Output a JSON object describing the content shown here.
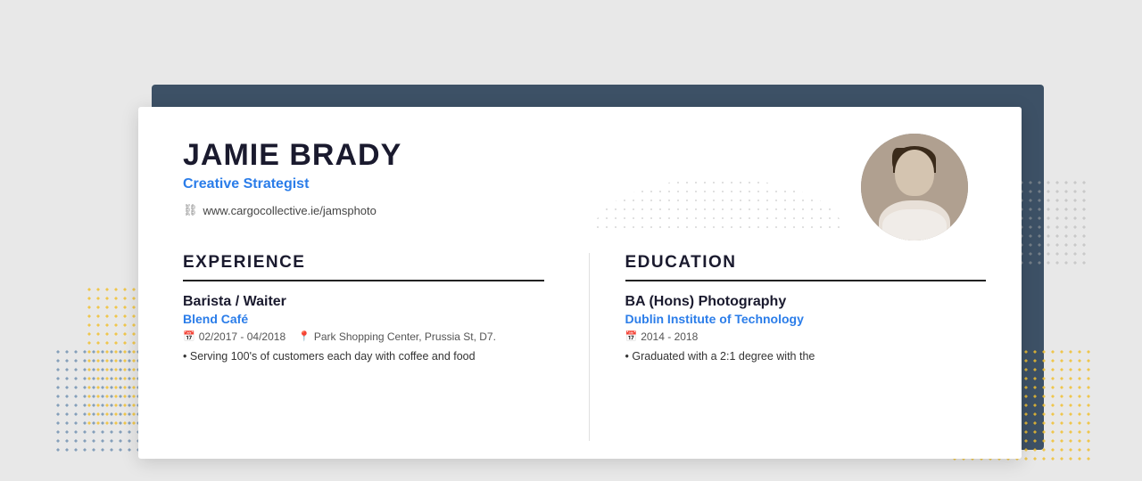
{
  "background": {
    "color": "#e8e8e8",
    "panel_color": "#3d5166"
  },
  "resume": {
    "name": "JAMIE BRADY",
    "title": "Creative Strategist",
    "website": "www.cargocollective.ie/jamsphoto",
    "sections": {
      "experience": {
        "label": "EXPERIENCE",
        "job": {
          "title": "Barista / Waiter",
          "company": "Blend Café",
          "dates": "02/2017 - 04/2018",
          "location": "Park Shopping Center, Prussia St, D7.",
          "description": "Serving 100's of customers each day with coffee and food"
        }
      },
      "education": {
        "label": "EDUCATION",
        "degree": {
          "title": "BA (Hons) Photography",
          "institution": "Dublin Institute of Technology",
          "dates": "2014 - 2018",
          "description": "Graduated with a 2:1 degree with the"
        }
      }
    }
  }
}
